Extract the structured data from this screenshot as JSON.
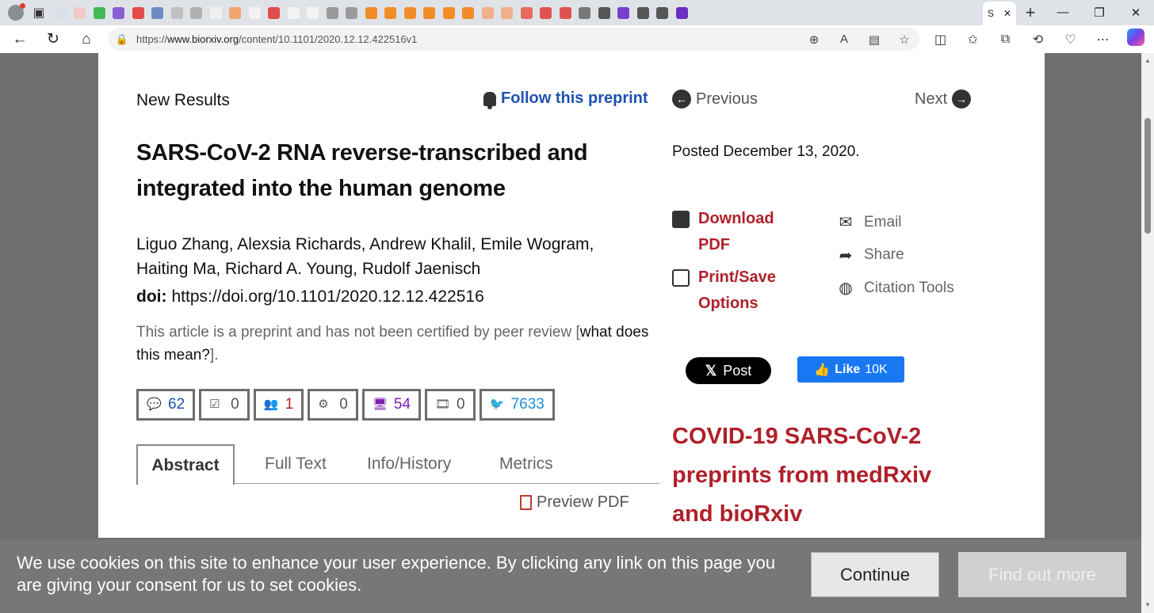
{
  "browser": {
    "active_tab_label": "S",
    "address_url_prefix": "https://",
    "address_url_host": "www.biorxiv.org",
    "address_url_path": "/content/10.1101/2020.12.12.422516v1",
    "tab_favicon_colors": [
      "#d9e0e8",
      "#f3c9c9",
      "#44b85a",
      "#8a5fd1",
      "#e54b4b",
      "#6d8bc6",
      "#c0c0c0",
      "#b0b0b0",
      "#f0f0f0",
      "#f4a46e",
      "#f3f3f3",
      "#dd4b4b",
      "#f3f3f3",
      "#f3f3f3",
      "#9a9a9a",
      "#9a9a9a",
      "#f28c28",
      "#f28c28",
      "#f28c28",
      "#f28c28",
      "#f28c28",
      "#f28c28",
      "#f0b08a",
      "#f0b08a",
      "#e86a5d",
      "#e05252",
      "#e05252",
      "#777777",
      "#555555",
      "#7a3fc8",
      "#555555",
      "#555555",
      "#6b2fbf"
    ]
  },
  "page": {
    "section_label": "New Results",
    "follow_label": "Follow this preprint",
    "title": "SARS-CoV-2 RNA reverse-transcribed and integrated into the human genome",
    "authors": "Liguo Zhang, Alexsia Richards, Andrew Khalil, Emile Wogram, Haiting Ma, Richard A. Young, Rudolf Jaenisch",
    "doi_label": "doi:",
    "doi_value": "https://doi.org/10.1101/2020.12.12.422516",
    "preprint_note_prefix": "This article is a preprint and has not been certified by peer review [",
    "preprint_note_link": "what does this mean?",
    "preprint_note_suffix": "].",
    "metrics": [
      {
        "name": "comments",
        "icon": "speech-bubble-icon",
        "value": "62",
        "color": "#1d52b1"
      },
      {
        "name": "reviews",
        "icon": "checkbox-icon",
        "value": "0",
        "color": "#555555"
      },
      {
        "name": "people",
        "icon": "users-icon",
        "value": "1",
        "color": "#b0202a"
      },
      {
        "name": "gears",
        "icon": "gears-icon",
        "value": "0",
        "color": "#555555"
      },
      {
        "name": "monitor",
        "icon": "monitor-icon",
        "value": "54",
        "color": "#7a1fb0"
      },
      {
        "name": "film",
        "icon": "film-icon",
        "value": "0",
        "color": "#555555"
      },
      {
        "name": "twitter",
        "icon": "twitter-icon",
        "value": "7633",
        "color": "#1d8fd8"
      }
    ],
    "tabs": [
      "Abstract",
      "Full Text",
      "Info/History",
      "Metrics"
    ],
    "preview_pdf_label": "Preview PDF",
    "prev_label": "Previous",
    "next_label": "Next",
    "posted": "Posted December 13, 2020.",
    "download_label": "Download PDF",
    "print_label": "Print/Save Options",
    "email_label": "Email",
    "share_label": "Share",
    "citation_label": "Citation Tools",
    "x_post_label": "Post",
    "fb_like_label": "Like",
    "fb_like_count": "10K",
    "covid_heading": "COVID-19 SARS-CoV-2 preprints from medRxiv and bioRxiv"
  },
  "cookie": {
    "text": "We use cookies on this site to enhance your user experience. By clicking any link on this page you are giving your consent for us to set cookies.",
    "continue_label": "Continue",
    "find_more_label": "Find out more"
  },
  "colors": {
    "brand_red": "#b0202a",
    "link_blue": "#1d52b1"
  }
}
